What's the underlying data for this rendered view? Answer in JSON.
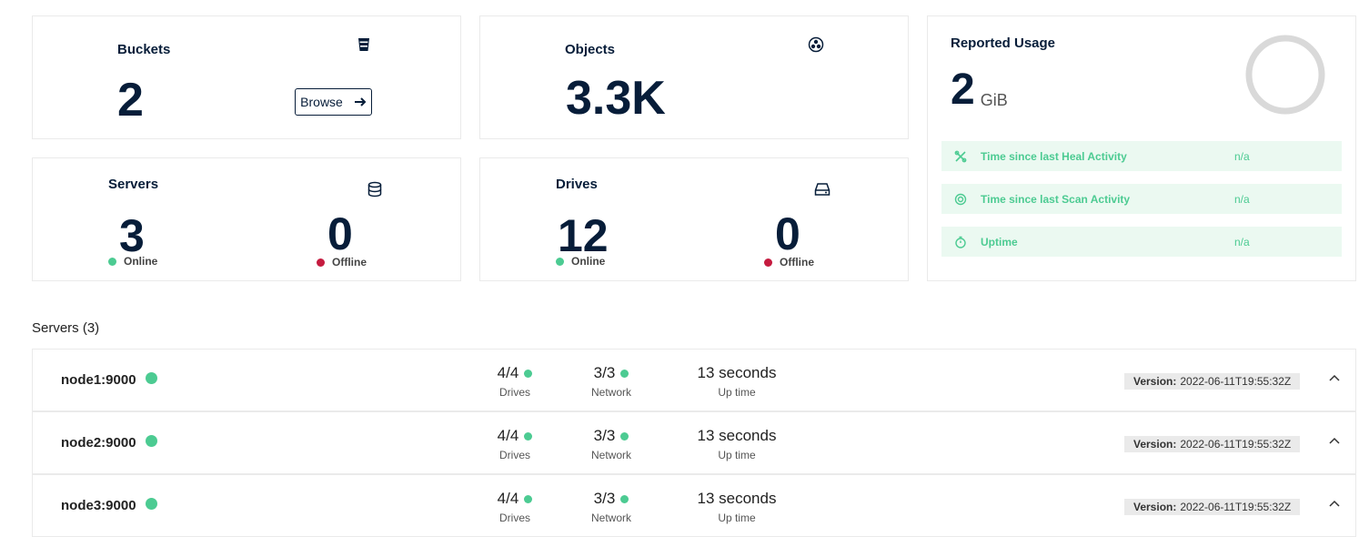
{
  "cards": {
    "buckets": {
      "title": "Buckets",
      "value": "2",
      "browse_label": "Browse"
    },
    "objects": {
      "title": "Objects",
      "value": "3.3K"
    },
    "servers": {
      "title": "Servers",
      "online_value": "3",
      "online_label": "Online",
      "offline_value": "0",
      "offline_label": "Offline"
    },
    "drives": {
      "title": "Drives",
      "online_value": "12",
      "online_label": "Online",
      "offline_value": "0",
      "offline_label": "Offline"
    },
    "usage": {
      "title": "Reported Usage",
      "value": "2",
      "unit": "GiB",
      "activities": [
        {
          "label": "Time since last Heal Activity",
          "value": "n/a",
          "icon": "heal-icon"
        },
        {
          "label": "Time since last Scan Activity",
          "value": "n/a",
          "icon": "scan-icon"
        },
        {
          "label": "Uptime",
          "value": "n/a",
          "icon": "stopwatch-icon"
        }
      ]
    }
  },
  "servers_section": {
    "title": "Servers (3)",
    "rows": [
      {
        "name": "node1:9000",
        "drives": "4/4",
        "drives_label": "Drives",
        "network": "3/3",
        "network_label": "Network",
        "uptime": "13 seconds",
        "uptime_label": "Up time",
        "version_label": "Version:",
        "version": "2022-06-11T19:55:32Z"
      },
      {
        "name": "node2:9000",
        "drives": "4/4",
        "drives_label": "Drives",
        "network": "3/3",
        "network_label": "Network",
        "uptime": "13 seconds",
        "uptime_label": "Up time",
        "version_label": "Version:",
        "version": "2022-06-11T19:55:32Z"
      },
      {
        "name": "node3:9000",
        "drives": "4/4",
        "drives_label": "Drives",
        "network": "3/3",
        "network_label": "Network",
        "uptime": "13 seconds",
        "uptime_label": "Up time",
        "version_label": "Version:",
        "version": "2022-06-11T19:55:32Z"
      }
    ]
  },
  "colors": {
    "online": "#4ccb92",
    "offline": "#c51b3f",
    "text_primary": "#071d39",
    "activity_bg": "#ebf9f1"
  }
}
